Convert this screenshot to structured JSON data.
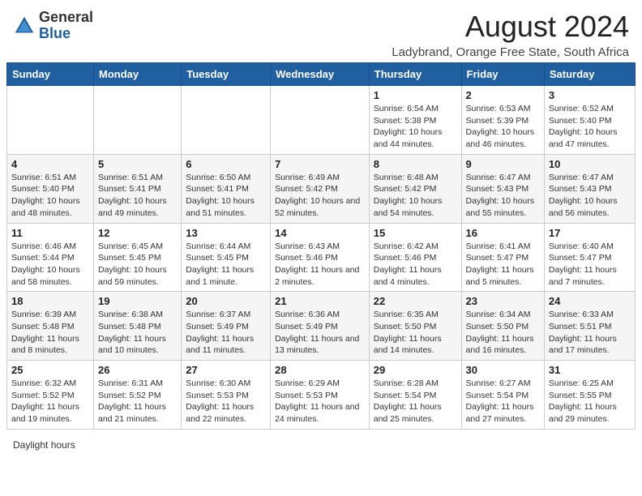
{
  "header": {
    "logo_general": "General",
    "logo_blue": "Blue",
    "month": "August 2024",
    "location": "Ladybrand, Orange Free State, South Africa"
  },
  "days_of_week": [
    "Sunday",
    "Monday",
    "Tuesday",
    "Wednesday",
    "Thursday",
    "Friday",
    "Saturday"
  ],
  "weeks": [
    [
      {
        "day": "",
        "sunrise": "",
        "sunset": "",
        "daylight": ""
      },
      {
        "day": "",
        "sunrise": "",
        "sunset": "",
        "daylight": ""
      },
      {
        "day": "",
        "sunrise": "",
        "sunset": "",
        "daylight": ""
      },
      {
        "day": "",
        "sunrise": "",
        "sunset": "",
        "daylight": ""
      },
      {
        "day": "1",
        "sunrise": "Sunrise: 6:54 AM",
        "sunset": "Sunset: 5:38 PM",
        "daylight": "Daylight: 10 hours and 44 minutes."
      },
      {
        "day": "2",
        "sunrise": "Sunrise: 6:53 AM",
        "sunset": "Sunset: 5:39 PM",
        "daylight": "Daylight: 10 hours and 46 minutes."
      },
      {
        "day": "3",
        "sunrise": "Sunrise: 6:52 AM",
        "sunset": "Sunset: 5:40 PM",
        "daylight": "Daylight: 10 hours and 47 minutes."
      }
    ],
    [
      {
        "day": "4",
        "sunrise": "Sunrise: 6:51 AM",
        "sunset": "Sunset: 5:40 PM",
        "daylight": "Daylight: 10 hours and 48 minutes."
      },
      {
        "day": "5",
        "sunrise": "Sunrise: 6:51 AM",
        "sunset": "Sunset: 5:41 PM",
        "daylight": "Daylight: 10 hours and 49 minutes."
      },
      {
        "day": "6",
        "sunrise": "Sunrise: 6:50 AM",
        "sunset": "Sunset: 5:41 PM",
        "daylight": "Daylight: 10 hours and 51 minutes."
      },
      {
        "day": "7",
        "sunrise": "Sunrise: 6:49 AM",
        "sunset": "Sunset: 5:42 PM",
        "daylight": "Daylight: 10 hours and 52 minutes."
      },
      {
        "day": "8",
        "sunrise": "Sunrise: 6:48 AM",
        "sunset": "Sunset: 5:42 PM",
        "daylight": "Daylight: 10 hours and 54 minutes."
      },
      {
        "day": "9",
        "sunrise": "Sunrise: 6:47 AM",
        "sunset": "Sunset: 5:43 PM",
        "daylight": "Daylight: 10 hours and 55 minutes."
      },
      {
        "day": "10",
        "sunrise": "Sunrise: 6:47 AM",
        "sunset": "Sunset: 5:43 PM",
        "daylight": "Daylight: 10 hours and 56 minutes."
      }
    ],
    [
      {
        "day": "11",
        "sunrise": "Sunrise: 6:46 AM",
        "sunset": "Sunset: 5:44 PM",
        "daylight": "Daylight: 10 hours and 58 minutes."
      },
      {
        "day": "12",
        "sunrise": "Sunrise: 6:45 AM",
        "sunset": "Sunset: 5:45 PM",
        "daylight": "Daylight: 10 hours and 59 minutes."
      },
      {
        "day": "13",
        "sunrise": "Sunrise: 6:44 AM",
        "sunset": "Sunset: 5:45 PM",
        "daylight": "Daylight: 11 hours and 1 minute."
      },
      {
        "day": "14",
        "sunrise": "Sunrise: 6:43 AM",
        "sunset": "Sunset: 5:46 PM",
        "daylight": "Daylight: 11 hours and 2 minutes."
      },
      {
        "day": "15",
        "sunrise": "Sunrise: 6:42 AM",
        "sunset": "Sunset: 5:46 PM",
        "daylight": "Daylight: 11 hours and 4 minutes."
      },
      {
        "day": "16",
        "sunrise": "Sunrise: 6:41 AM",
        "sunset": "Sunset: 5:47 PM",
        "daylight": "Daylight: 11 hours and 5 minutes."
      },
      {
        "day": "17",
        "sunrise": "Sunrise: 6:40 AM",
        "sunset": "Sunset: 5:47 PM",
        "daylight": "Daylight: 11 hours and 7 minutes."
      }
    ],
    [
      {
        "day": "18",
        "sunrise": "Sunrise: 6:39 AM",
        "sunset": "Sunset: 5:48 PM",
        "daylight": "Daylight: 11 hours and 8 minutes."
      },
      {
        "day": "19",
        "sunrise": "Sunrise: 6:38 AM",
        "sunset": "Sunset: 5:48 PM",
        "daylight": "Daylight: 11 hours and 10 minutes."
      },
      {
        "day": "20",
        "sunrise": "Sunrise: 6:37 AM",
        "sunset": "Sunset: 5:49 PM",
        "daylight": "Daylight: 11 hours and 11 minutes."
      },
      {
        "day": "21",
        "sunrise": "Sunrise: 6:36 AM",
        "sunset": "Sunset: 5:49 PM",
        "daylight": "Daylight: 11 hours and 13 minutes."
      },
      {
        "day": "22",
        "sunrise": "Sunrise: 6:35 AM",
        "sunset": "Sunset: 5:50 PM",
        "daylight": "Daylight: 11 hours and 14 minutes."
      },
      {
        "day": "23",
        "sunrise": "Sunrise: 6:34 AM",
        "sunset": "Sunset: 5:50 PM",
        "daylight": "Daylight: 11 hours and 16 minutes."
      },
      {
        "day": "24",
        "sunrise": "Sunrise: 6:33 AM",
        "sunset": "Sunset: 5:51 PM",
        "daylight": "Daylight: 11 hours and 17 minutes."
      }
    ],
    [
      {
        "day": "25",
        "sunrise": "Sunrise: 6:32 AM",
        "sunset": "Sunset: 5:52 PM",
        "daylight": "Daylight: 11 hours and 19 minutes."
      },
      {
        "day": "26",
        "sunrise": "Sunrise: 6:31 AM",
        "sunset": "Sunset: 5:52 PM",
        "daylight": "Daylight: 11 hours and 21 minutes."
      },
      {
        "day": "27",
        "sunrise": "Sunrise: 6:30 AM",
        "sunset": "Sunset: 5:53 PM",
        "daylight": "Daylight: 11 hours and 22 minutes."
      },
      {
        "day": "28",
        "sunrise": "Sunrise: 6:29 AM",
        "sunset": "Sunset: 5:53 PM",
        "daylight": "Daylight: 11 hours and 24 minutes."
      },
      {
        "day": "29",
        "sunrise": "Sunrise: 6:28 AM",
        "sunset": "Sunset: 5:54 PM",
        "daylight": "Daylight: 11 hours and 25 minutes."
      },
      {
        "day": "30",
        "sunrise": "Sunrise: 6:27 AM",
        "sunset": "Sunset: 5:54 PM",
        "daylight": "Daylight: 11 hours and 27 minutes."
      },
      {
        "day": "31",
        "sunrise": "Sunrise: 6:25 AM",
        "sunset": "Sunset: 5:55 PM",
        "daylight": "Daylight: 11 hours and 29 minutes."
      }
    ]
  ],
  "footer": {
    "daylight_label": "Daylight hours"
  }
}
